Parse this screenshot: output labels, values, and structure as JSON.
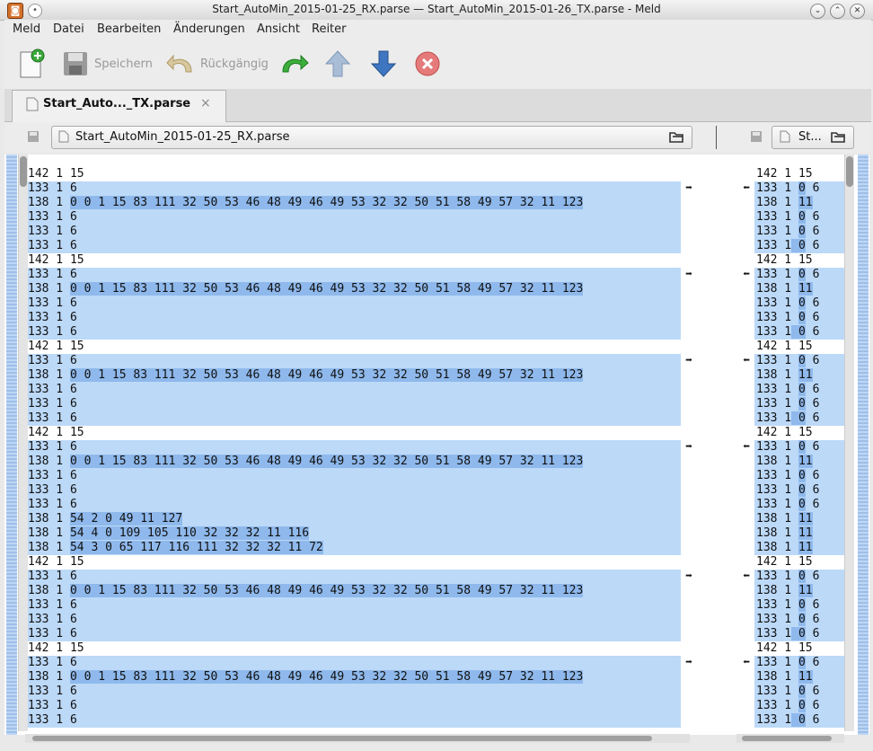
{
  "window": {
    "title": "Start_AutoMin_2015-01-25_RX.parse — Start_AutoMin_2015-01-26_TX.parse - Meld",
    "app_icon": "meld-icon",
    "controls": [
      "minimize-icon",
      "maximize-icon",
      "close-icon"
    ]
  },
  "menubar": {
    "items": [
      "Meld",
      "Datei",
      "Bearbeiten",
      "Änderungen",
      "Ansicht",
      "Reiter"
    ]
  },
  "toolbar": {
    "new_icon": "new-document-icon",
    "save_label": "Speichern",
    "undo_label": "Rückgängig",
    "redo_icon": "redo-icon",
    "prev_change_icon": "arrow-up-icon",
    "next_change_icon": "arrow-down-icon",
    "stop_icon": "stop-icon"
  },
  "tab": {
    "label": "Start_Auto..._TX.parse",
    "close": "×"
  },
  "files": {
    "left": "Start_AutoMin_2015-01-25_RX.parse",
    "right": "St..."
  },
  "diff": {
    "colors": {
      "changed": "#bcd9f8",
      "inline": "#8fb9ec",
      "equal": "#ffffff"
    },
    "left_lines": [
      {
        "prefix": "142 1 15",
        "hl": "",
        "chg": false
      },
      {
        "prefix": "133 1 6",
        "hl": "",
        "chg": true
      },
      {
        "prefix": "138 1 ",
        "hl": "0 0 1 15 83 111 32 50 53 46 48 49 46 49 53 32 32 50 51 58 49 57 32 11 123",
        "chg": true
      },
      {
        "prefix": "133 1 6",
        "hl": "",
        "chg": true
      },
      {
        "prefix": "133 1 6",
        "hl": "",
        "chg": true
      },
      {
        "prefix": "133 1 6",
        "hl": "",
        "chg": true
      },
      {
        "prefix": "142 1 15",
        "hl": "",
        "chg": false
      },
      {
        "prefix": "133 1 6",
        "hl": "",
        "chg": true
      },
      {
        "prefix": "138 1 ",
        "hl": "0 0 1 15 83 111 32 50 53 46 48 49 46 49 53 32 32 50 51 58 49 57 32 11 123",
        "chg": true
      },
      {
        "prefix": "133 1 6",
        "hl": "",
        "chg": true
      },
      {
        "prefix": "133 1 6",
        "hl": "",
        "chg": true
      },
      {
        "prefix": "133 1 6",
        "hl": "",
        "chg": true
      },
      {
        "prefix": "142 1 15",
        "hl": "",
        "chg": false
      },
      {
        "prefix": "133 1 6",
        "hl": "",
        "chg": true
      },
      {
        "prefix": "138 1 ",
        "hl": "0 0 1 15 83 111 32 50 53 46 48 49 46 49 53 32 32 50 51 58 49 57 32 11 123",
        "chg": true
      },
      {
        "prefix": "133 1 6",
        "hl": "",
        "chg": true
      },
      {
        "prefix": "133 1 6",
        "hl": "",
        "chg": true
      },
      {
        "prefix": "133 1 6",
        "hl": "",
        "chg": true
      },
      {
        "prefix": "142 1 15",
        "hl": "",
        "chg": false
      },
      {
        "prefix": "133 1 6",
        "hl": "",
        "chg": true
      },
      {
        "prefix": "138 1 ",
        "hl": "0 0 1 15 83 111 32 50 53 46 48 49 46 49 53 32 32 50 51 58 49 57 32 11 123",
        "chg": true
      },
      {
        "prefix": "133 1 6",
        "hl": "",
        "chg": true
      },
      {
        "prefix": "133 1 6",
        "hl": "",
        "chg": true
      },
      {
        "prefix": "133 1 6",
        "hl": "",
        "chg": true
      },
      {
        "prefix": "138 1 ",
        "hl": "54 2 0 49 11 127",
        "chg": true
      },
      {
        "prefix": "138 1 ",
        "hl": "54 4 0 109 105 110 32 32 32 11 116",
        "chg": true
      },
      {
        "prefix": "138 1 ",
        "hl": "54 3 0 65 117 116 111 32 32 32 11 72",
        "chg": true
      },
      {
        "prefix": "142 1 15",
        "hl": "",
        "chg": false
      },
      {
        "prefix": "133 1 6",
        "hl": "",
        "chg": true
      },
      {
        "prefix": "138 1 ",
        "hl": "0 0 1 15 83 111 32 50 53 46 48 49 46 49 53 32 32 50 51 58 49 57 32 11 123",
        "chg": true
      },
      {
        "prefix": "133 1 6",
        "hl": "",
        "chg": true
      },
      {
        "prefix": "133 1 6",
        "hl": "",
        "chg": true
      },
      {
        "prefix": "133 1 6",
        "hl": "",
        "chg": true
      },
      {
        "prefix": "142 1 15",
        "hl": "",
        "chg": false
      },
      {
        "prefix": "133 1 6",
        "hl": "",
        "chg": true
      },
      {
        "prefix": "138 1 ",
        "hl": "0 0 1 15 83 111 32 50 53 46 48 49 46 49 53 32 32 50 51 58 49 57 32 11 123",
        "chg": true
      },
      {
        "prefix": "133 1 6",
        "hl": "",
        "chg": true
      },
      {
        "prefix": "133 1 6",
        "hl": "",
        "chg": true
      },
      {
        "prefix": "133 1 6",
        "hl": "",
        "chg": true
      }
    ],
    "right_lines": [
      {
        "prefix": "142 1 15",
        "hl": "",
        "suffix": "",
        "chg": false
      },
      {
        "prefix": "133 1 ",
        "hl": "0",
        "suffix": " 6",
        "chg": true
      },
      {
        "prefix": "138 1 ",
        "hl": "11",
        "suffix": "",
        "chg": true
      },
      {
        "prefix": "133 1 ",
        "hl": "0",
        "suffix": " 6",
        "chg": true
      },
      {
        "prefix": "133 1 ",
        "hl": "0",
        "suffix": " 6",
        "chg": true
      },
      {
        "prefix": "133 1",
        "hl": " 0",
        "suffix": " 6",
        "chg": true
      },
      {
        "prefix": "142 1 15",
        "hl": "",
        "suffix": "",
        "chg": false
      },
      {
        "prefix": "133 1 ",
        "hl": "0",
        "suffix": " 6",
        "chg": true
      },
      {
        "prefix": "138 1 ",
        "hl": "11",
        "suffix": "",
        "chg": true
      },
      {
        "prefix": "133 1 ",
        "hl": "0",
        "suffix": " 6",
        "chg": true
      },
      {
        "prefix": "133 1 ",
        "hl": "0",
        "suffix": " 6",
        "chg": true
      },
      {
        "prefix": "133 1",
        "hl": " 0",
        "suffix": " 6",
        "chg": true
      },
      {
        "prefix": "142 1 15",
        "hl": "",
        "suffix": "",
        "chg": false
      },
      {
        "prefix": "133 1 ",
        "hl": "0",
        "suffix": " 6",
        "chg": true
      },
      {
        "prefix": "138 1 ",
        "hl": "11",
        "suffix": "",
        "chg": true
      },
      {
        "prefix": "133 1 ",
        "hl": "0",
        "suffix": " 6",
        "chg": true
      },
      {
        "prefix": "133 1 ",
        "hl": "0",
        "suffix": " 6",
        "chg": true
      },
      {
        "prefix": "133 1",
        "hl": " 0",
        "suffix": " 6",
        "chg": true
      },
      {
        "prefix": "142 1 15",
        "hl": "",
        "suffix": "",
        "chg": false
      },
      {
        "prefix": "133 1 ",
        "hl": "0",
        "suffix": " 6",
        "chg": true
      },
      {
        "prefix": "138 1 ",
        "hl": "11",
        "suffix": "",
        "chg": true
      },
      {
        "prefix": "133 1 ",
        "hl": "0",
        "suffix": " 6",
        "chg": true
      },
      {
        "prefix": "133 1 ",
        "hl": "0",
        "suffix": " 6",
        "chg": true
      },
      {
        "prefix": "133 1 ",
        "hl": "0",
        "suffix": " 6",
        "chg": true
      },
      {
        "prefix": "138 1 ",
        "hl": "11",
        "suffix": "",
        "chg": true
      },
      {
        "prefix": "138 1 ",
        "hl": "11",
        "suffix": "",
        "chg": true
      },
      {
        "prefix": "138 1 ",
        "hl": "11",
        "suffix": "",
        "chg": true
      },
      {
        "prefix": "142 1 15",
        "hl": "",
        "suffix": "",
        "chg": false
      },
      {
        "prefix": "133 1 ",
        "hl": "0",
        "suffix": " 6",
        "chg": true
      },
      {
        "prefix": "138 1 ",
        "hl": "11",
        "suffix": "",
        "chg": true
      },
      {
        "prefix": "133 1 ",
        "hl": "0",
        "suffix": " 6",
        "chg": true
      },
      {
        "prefix": "133 1 ",
        "hl": "0",
        "suffix": " 6",
        "chg": true
      },
      {
        "prefix": "133 1",
        "hl": " 0",
        "suffix": " 6",
        "chg": true
      },
      {
        "prefix": "142 1 15",
        "hl": "",
        "suffix": "",
        "chg": false
      },
      {
        "prefix": "133 1 ",
        "hl": "0",
        "suffix": " 6",
        "chg": true
      },
      {
        "prefix": "138 1 ",
        "hl": "11",
        "suffix": "",
        "chg": true
      },
      {
        "prefix": "133 1 ",
        "hl": "0",
        "suffix": " 6",
        "chg": true
      },
      {
        "prefix": "133 1 ",
        "hl": "0",
        "suffix": " 6",
        "chg": true
      },
      {
        "prefix": "133 1",
        "hl": " 0",
        "suffix": " 6",
        "chg": true
      }
    ],
    "link_rows": [
      1,
      7,
      13,
      19,
      28,
      34
    ]
  }
}
